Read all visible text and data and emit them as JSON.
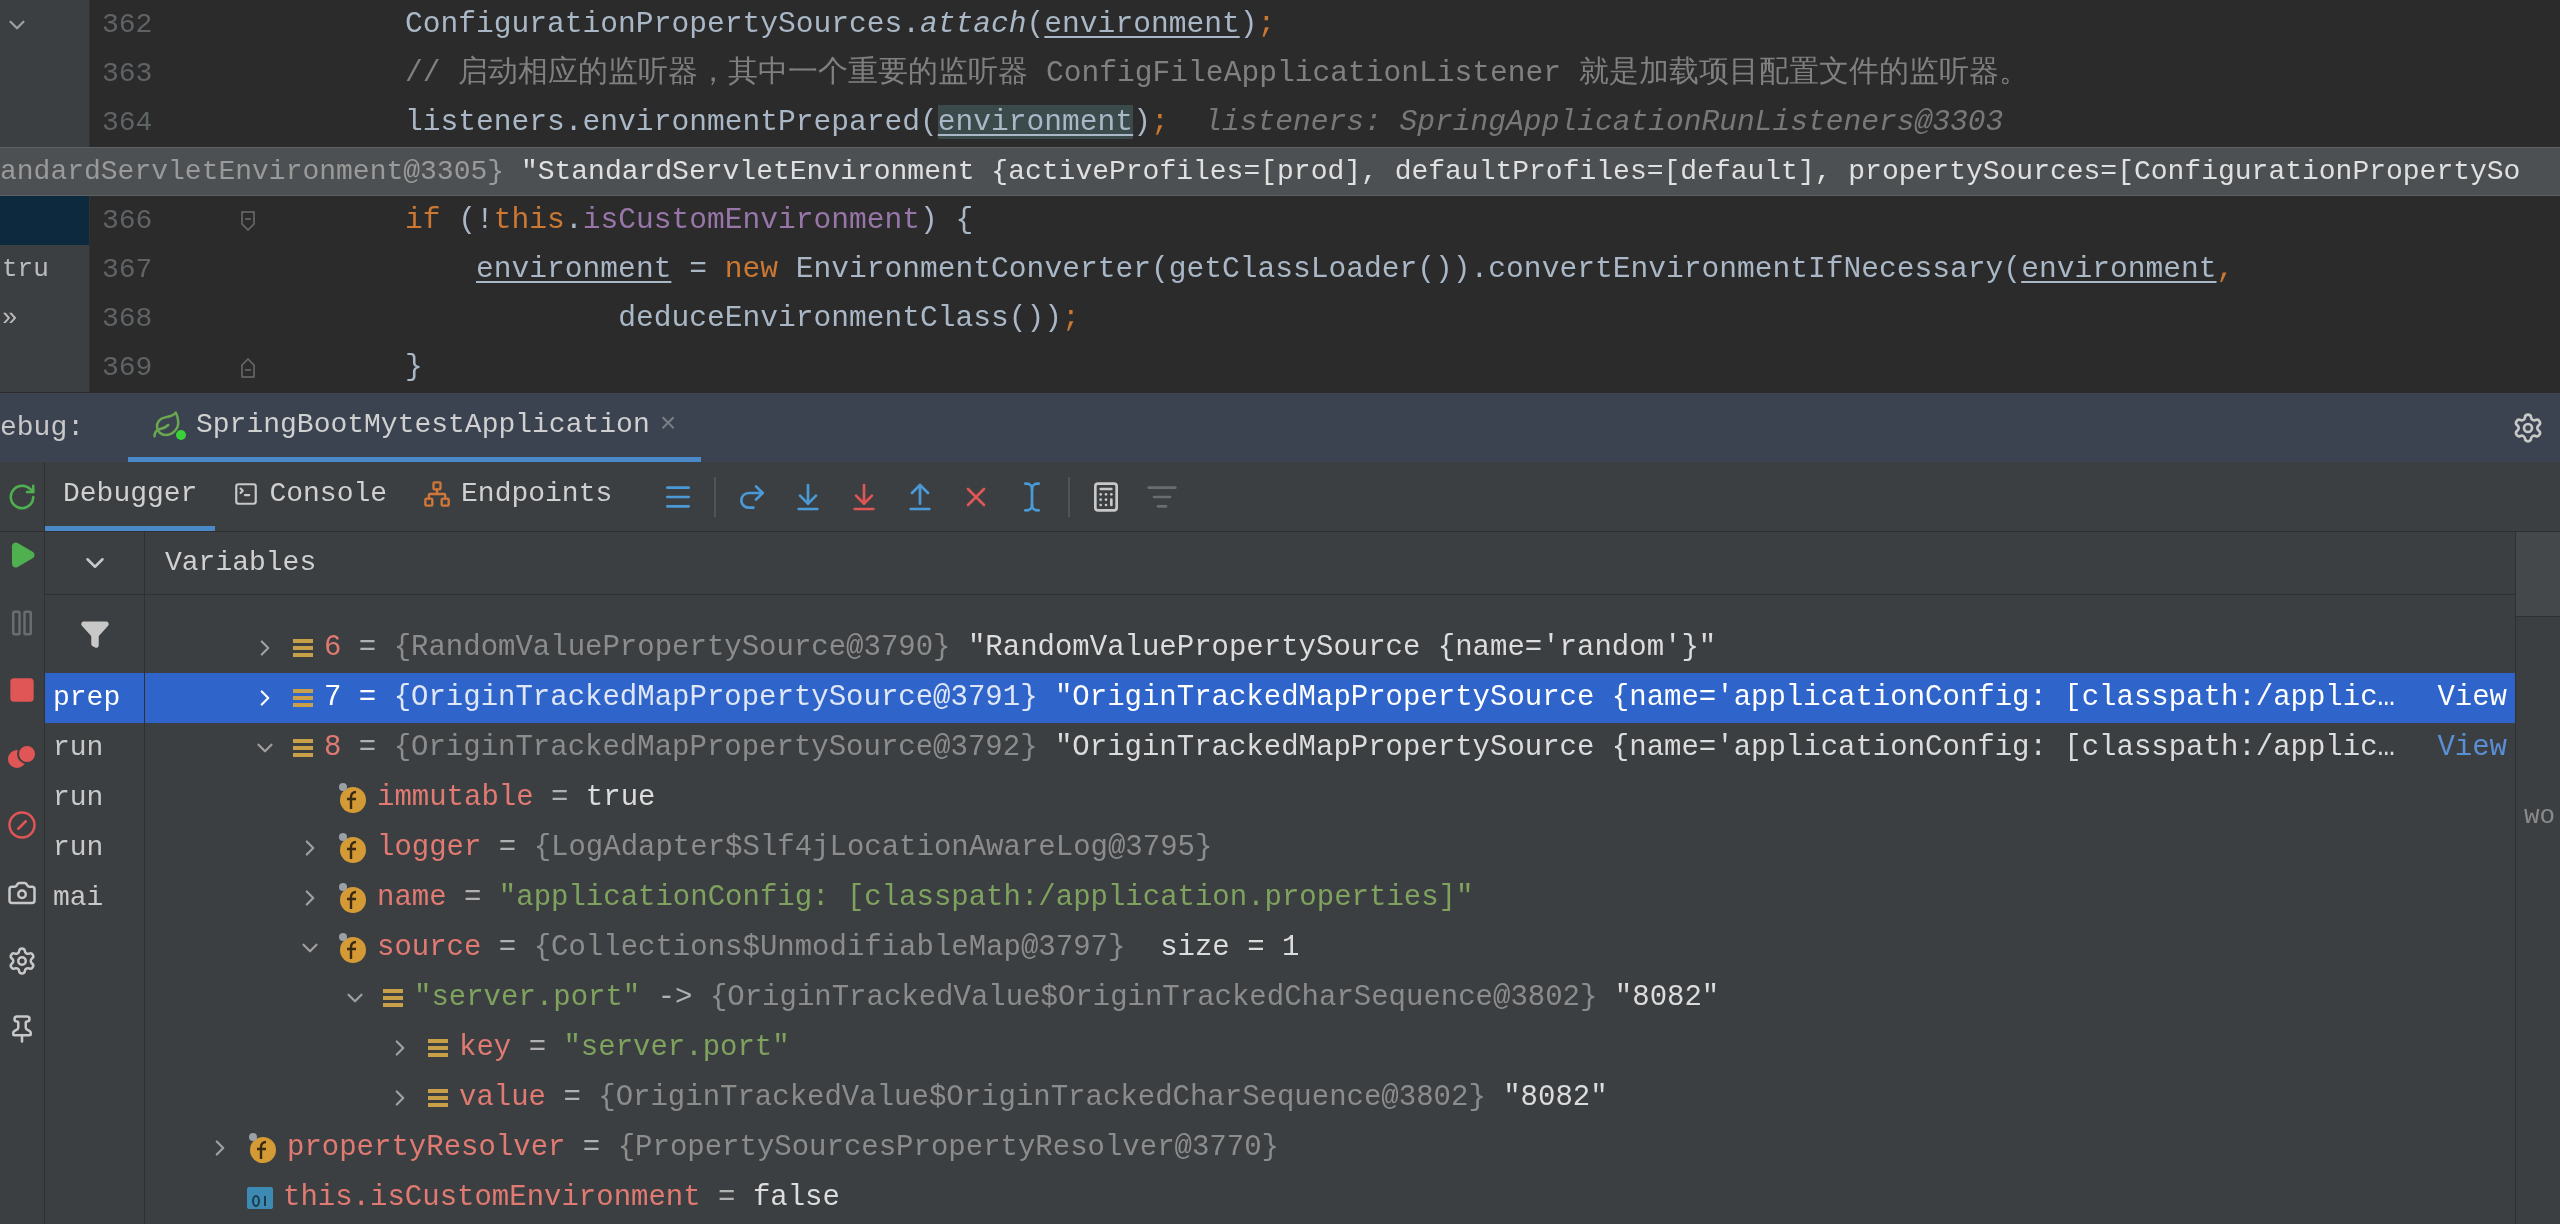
{
  "editor": {
    "lines": [
      {
        "kind": "code",
        "number": "362",
        "side": {
          "kind": "chevron"
        },
        "side_selected": false,
        "tokens": [
          {
            "text": "ConfigurationPropertySources.",
            "kind": "plain"
          },
          {
            "text": "attach",
            "kind": "italic"
          },
          {
            "text": "(",
            "kind": "plain"
          },
          {
            "text": "environment",
            "kind": "var"
          },
          {
            "text": ")",
            "kind": "plain"
          },
          {
            "text": ";",
            "kind": "punct"
          }
        ]
      },
      {
        "kind": "code",
        "number": "363",
        "side_selected": false,
        "tokens": [
          {
            "text": "// 启动相应的监听器，其中一个重要的监听器 ConfigFileApplicationListener 就是加载项目配置文件的监听器。",
            "kind": "comment"
          }
        ]
      },
      {
        "kind": "code",
        "number": "364",
        "side_selected": false,
        "tokens": [
          {
            "text": "listeners.environmentPrepared(",
            "kind": "plain"
          },
          {
            "text": "environment",
            "kind": "highlight"
          },
          {
            "text": ")",
            "kind": "plain"
          },
          {
            "text": ";",
            "kind": "punct"
          },
          {
            "text": "  listeners: SpringApplicationRunListeners@3303",
            "kind": "hint"
          }
        ]
      },
      {
        "kind": "tooltip",
        "tokens": [
          {
            "text": "andardServletEnvironment@3305}",
            "kind": "type"
          },
          {
            "text": " \"StandardServletEnvironment {activeProfiles=[prod], defaultProfiles=[default], propertySources=[ConfigurationPropertySo",
            "kind": "value"
          }
        ]
      },
      {
        "kind": "block-start",
        "number": "366",
        "side_selected": true,
        "tokens": [
          {
            "text": "if",
            "kind": "keyword"
          },
          {
            "text": " (!",
            "kind": "plain"
          },
          {
            "text": "this",
            "kind": "keyword"
          },
          {
            "text": ".",
            "kind": "plain"
          },
          {
            "text": "isCustomEnvironment",
            "kind": "field"
          },
          {
            "text": ") {",
            "kind": "plain"
          }
        ]
      },
      {
        "kind": "code",
        "number": "367",
        "side": {
          "kind": "text",
          "text": "tru"
        },
        "side_selected": false,
        "tokens": [
          {
            "text": "    environment",
            "kind": "var"
          },
          {
            "text": " = ",
            "kind": "plain"
          },
          {
            "text": "new",
            "kind": "keyword"
          },
          {
            "text": " EnvironmentConverter(getClassLoader()).convertEnvironmentIfNecessary(",
            "kind": "plain"
          },
          {
            "text": "environment",
            "kind": "var"
          },
          {
            "text": ",",
            "kind": "punct"
          }
        ]
      },
      {
        "kind": "code",
        "number": "368",
        "side": {
          "kind": "text",
          "text": "»"
        },
        "side_selected": false,
        "tokens": [
          {
            "text": "            deduceEnvironmentClass())",
            "kind": "plain"
          },
          {
            "text": ";",
            "kind": "punct"
          }
        ]
      },
      {
        "kind": "block-end",
        "number": "369",
        "side_selected": false,
        "tokens": [
          {
            "text": "}",
            "kind": "plain"
          }
        ]
      }
    ]
  },
  "debug": {
    "label": "ebug:",
    "session_tab": {
      "title": "SpringBootMytestApplication",
      "selected": true,
      "close": "×"
    },
    "tabs": [
      {
        "label": "Debugger",
        "kind": "debugger",
        "selected": true
      },
      {
        "label": "Console",
        "kind": "console",
        "selected": false
      },
      {
        "label": "Endpoints",
        "kind": "endpoints",
        "selected": false
      }
    ],
    "frames": [
      {
        "label": "prep",
        "selected": true
      },
      {
        "label": "run",
        "selected": false
      },
      {
        "label": "run",
        "selected": false
      },
      {
        "label": "run",
        "selected": false
      },
      {
        "label": "mai",
        "selected": false
      }
    ],
    "variables": {
      "title": "Variables",
      "tree": [
        {
          "children": [
            {
              "children": [
                {
                  "kind": "entry",
                  "expanded": false,
                  "selected": false,
                  "tokens": [
                    {
                      "text": "6",
                      "kind": "name"
                    },
                    {
                      "text": " = ",
                      "kind": "op"
                    },
                    {
                      "text": "{RandomValuePropertySource@3790}",
                      "kind": "type"
                    },
                    {
                      "text": " \"RandomValuePropertySource {name='random'}\"",
                      "kind": "value"
                    }
                  ]
                },
                {
                  "kind": "entry",
                  "expanded": false,
                  "selected": true,
                  "link": "View",
                  "tokens": [
                    {
                      "text": "7",
                      "kind": "name"
                    },
                    {
                      "text": " = ",
                      "kind": "op"
                    },
                    {
                      "text": "{OriginTrackedMapPropertySource@3791}",
                      "kind": "type"
                    },
                    {
                      "text": " \"OriginTrackedMapPropertySource {name='applicationConfig: [classpath:/applic…",
                      "kind": "value"
                    }
                  ]
                },
                {
                  "kind": "entry",
                  "expanded": true,
                  "selected": false,
                  "link": "View",
                  "tokens": [
                    {
                      "text": "8",
                      "kind": "name"
                    },
                    {
                      "text": " = ",
                      "kind": "op"
                    },
                    {
                      "text": "{OriginTrackedMapPropertySource@3792}",
                      "kind": "type"
                    },
                    {
                      "text": " \"OriginTrackedMapPropertySource {name='applicationConfig: [classpath:/applic…",
                      "kind": "value"
                    }
                  ],
                  "children": [
                    {
                      "kind": "field",
                      "selected": false,
                      "tokens": [
                        {
                          "text": "immutable",
                          "kind": "name"
                        },
                        {
                          "text": " = ",
                          "kind": "op"
                        },
                        {
                          "text": "true",
                          "kind": "value"
                        }
                      ]
                    },
                    {
                      "kind": "field",
                      "expanded": false,
                      "selected": false,
                      "tokens": [
                        {
                          "text": "logger",
                          "kind": "name"
                        },
                        {
                          "text": " = ",
                          "kind": "op"
                        },
                        {
                          "text": "{LogAdapter$Slf4jLocationAwareLog@3795}",
                          "kind": "type"
                        }
                      ]
                    },
                    {
                      "kind": "field",
                      "expanded": false,
                      "selected": false,
                      "tokens": [
                        {
                          "text": "name",
                          "kind": "name"
                        },
                        {
                          "text": " = ",
                          "kind": "op"
                        },
                        {
                          "text": "\"applicationConfig: [classpath:/application.properties]\"",
                          "kind": "string"
                        }
                      ]
                    },
                    {
                      "kind": "field",
                      "expanded": true,
                      "selected": false,
                      "tokens": [
                        {
                          "text": "source",
                          "kind": "name"
                        },
                        {
                          "text": " = ",
                          "kind": "op"
                        },
                        {
                          "text": "{Collections$UnmodifiableMap@3797}",
                          "kind": "type"
                        },
                        {
                          "text": "  size = 1",
                          "kind": "value"
                        }
                      ],
                      "children": [
                        {
                          "kind": "entry",
                          "expanded": true,
                          "selected": false,
                          "tokens": [
                            {
                              "text": "\"server.port\"",
                              "kind": "string"
                            },
                            {
                              "text": " -> ",
                              "kind": "op"
                            },
                            {
                              "text": "{OriginTrackedValue$OriginTrackedCharSequence@3802}",
                              "kind": "type"
                            },
                            {
                              "text": " \"8082\"",
                              "kind": "value"
                            }
                          ],
                          "children": [
                            {
                              "kind": "entry",
                              "expanded": false,
                              "selected": false,
                              "tokens": [
                                {
                                  "text": "key",
                                  "kind": "name"
                                },
                                {
                                  "text": " = ",
                                  "kind": "op"
                                },
                                {
                                  "text": "\"server.port\"",
                                  "kind": "string"
                                }
                              ]
                            },
                            {
                              "kind": "entry",
                              "expanded": false,
                              "selected": false,
                              "tokens": [
                                {
                                  "text": "value",
                                  "kind": "name"
                                },
                                {
                                  "text": " = ",
                                  "kind": "op"
                                },
                                {
                                  "text": "{OriginTrackedValue$OriginTrackedCharSequence@3802}",
                                  "kind": "type"
                                },
                                {
                                  "text": " \"8082\"",
                                  "kind": "value"
                                }
                              ]
                            }
                          ]
                        }
                      ]
                    }
                  ]
                }
              ]
            }
          ]
        },
        {
          "kind": "field",
          "expanded": false,
          "selected": false,
          "tokens": [
            {
              "text": "propertyResolver",
              "kind": "name"
            },
            {
              "text": " = ",
              "kind": "op"
            },
            {
              "text": "{PropertySourcesPropertyResolver@3770}",
              "kind": "type"
            }
          ]
        },
        {
          "kind": "primitive",
          "selected": false,
          "tokens": [
            {
              "text": "this.isCustomEnvironment",
              "kind": "name"
            },
            {
              "text": " = ",
              "kind": "op"
            },
            {
              "text": "false",
              "kind": "value"
            }
          ]
        }
      ]
    },
    "side_fragment": "wo"
  }
}
